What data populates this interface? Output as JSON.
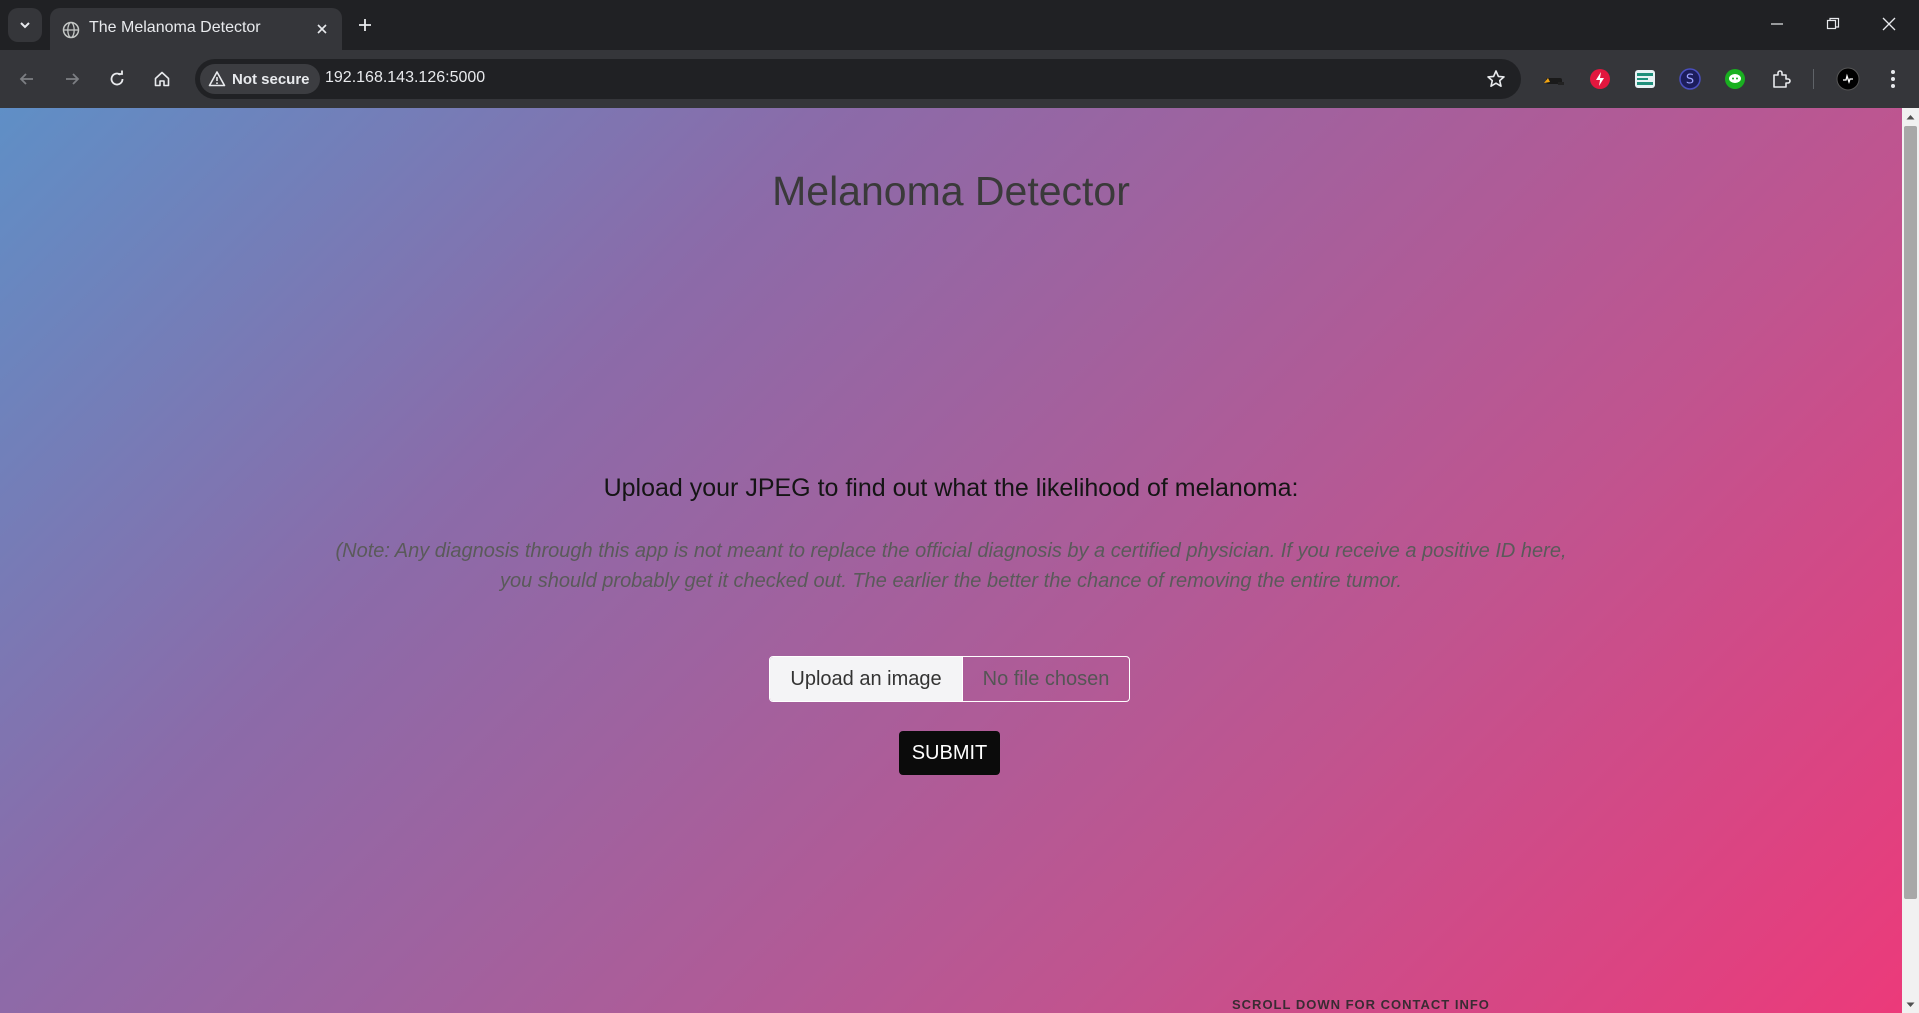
{
  "browser": {
    "tab_title": "The Melanoma Detector",
    "security_label": "Not secure",
    "url": "192.168.143.126:5000",
    "icons": [
      "tab-search-icon",
      "globe-icon",
      "close-icon",
      "plus-icon",
      "minimize-icon",
      "restore-icon",
      "close-window-icon",
      "back-icon",
      "forward-icon",
      "reload-icon",
      "home-icon",
      "warning-icon",
      "star-icon",
      "extensions-icon",
      "profile-icon"
    ]
  },
  "page": {
    "title": "Melanoma Detector",
    "upload_heading": "Upload your JPEG to find out what the likelihood of melanoma:",
    "note": "(Note: Any diagnosis through this app is not meant to replace the official diagnosis by a certified physician. If you receive a positive ID here, you should probably get it checked out. The earlier the better the chance of removing the entire tumor.",
    "file_button_label": "Upload an image",
    "file_status": "No file chosen",
    "submit_label": "SUBMIT",
    "scroll_hint": "SCROLL DOWN FOR CONTACT INFO"
  },
  "colors": {
    "gradient_start": "#5f8fc6",
    "gradient_mid": "#8b6ba9",
    "gradient_end": "#ec3a7a",
    "submit_bg": "#0b0b0b"
  }
}
